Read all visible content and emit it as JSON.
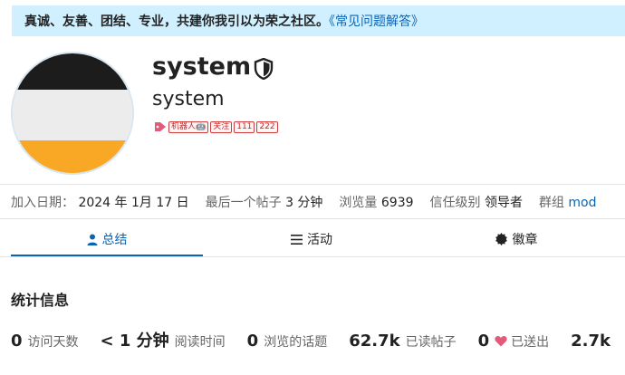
{
  "banner": {
    "message": "真诚、友善、团结、专业，共建你我引以为荣之社区。",
    "faq_link": "《常见问题解答》"
  },
  "profile": {
    "username": "system",
    "name": "system",
    "badges": [
      "机器人🤖",
      "关注",
      "111",
      "222"
    ]
  },
  "meta": {
    "joined_label": "加入日期：",
    "joined_value": "2024 年 1月 17 日",
    "last_post_label": "最后一个帖子",
    "last_post_value": "3 分钟",
    "views_label": "浏览量",
    "views_value": "6939",
    "trust_label": "信任级别",
    "trust_value": "领导者",
    "group_label": "群组",
    "group_value": "mod"
  },
  "tabs": [
    {
      "label": "总结",
      "active": true,
      "icon": "user-icon"
    },
    {
      "label": "活动",
      "active": false,
      "icon": "list-icon"
    },
    {
      "label": "徽章",
      "active": false,
      "icon": "badge-certificate-icon"
    }
  ],
  "section_title": "统计信息",
  "stats": [
    {
      "value": "0",
      "label": "访问天数"
    },
    {
      "value": "< 1 分钟",
      "label": "阅读时间"
    },
    {
      "value": "0",
      "label": "浏览的话题"
    },
    {
      "value": "62.7k",
      "label": "已读帖子"
    },
    {
      "value": "0",
      "label": "已送出",
      "icon": "heart-icon"
    },
    {
      "value": "2.7k",
      "label": ""
    }
  ],
  "colors": {
    "banner_bg": "#d1f0ff",
    "link": "#0a64b2",
    "heart": "#e45b7a",
    "badge_border": "#d23b3b"
  }
}
